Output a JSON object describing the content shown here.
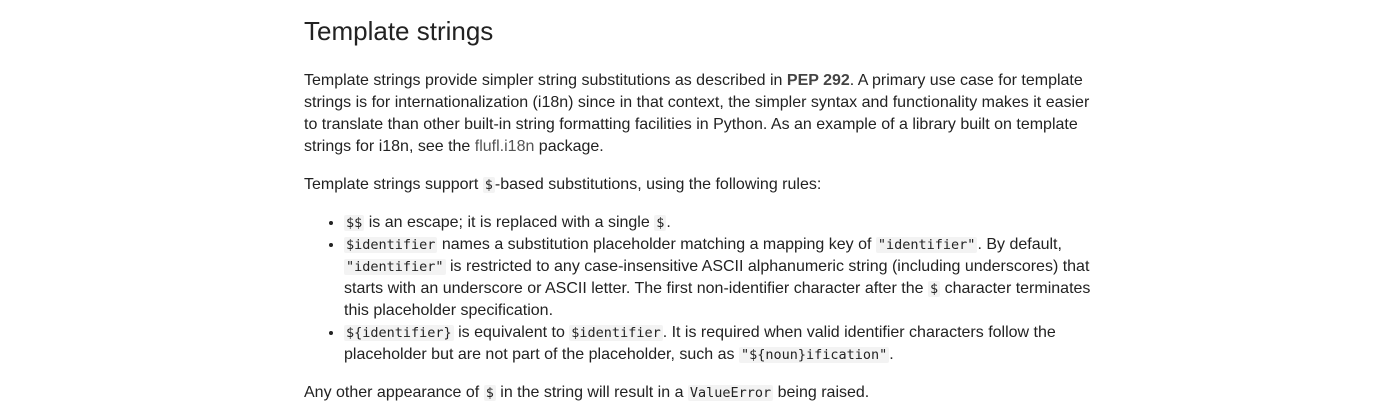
{
  "section": {
    "title": "Template strings"
  },
  "intro": {
    "t1": "Template strings provide simpler string substitutions as described in ",
    "pep_link": "PEP 292",
    "t2": ". A primary use case for template strings is for internationalization (i18n) since in that context, the simpler syntax and functionality makes it easier to translate than other built-in string formatting facilities in Python. As an example of a library built on template strings for i18n, see the ",
    "pkg_link": "flufl.i18n",
    "t3": " package."
  },
  "rules_intro": {
    "t1": "Template strings support ",
    "code": "$",
    "t2": "-based substitutions, using the following rules:"
  },
  "rules": [
    {
      "c1": "$$",
      "t1": " is an escape; it is replaced with a single ",
      "c2": "$",
      "t2": "."
    },
    {
      "c1": "$identifier",
      "t1": " names a substitution placeholder matching a mapping key of ",
      "c2": "\"identifier\"",
      "t2": ". By default, ",
      "c3": "\"identifier\"",
      "t3": " is restricted to any case-insensitive ASCII alphanumeric string (including underscores) that starts with an underscore or ASCII letter. The first non-identifier character after the ",
      "c4": "$",
      "t4": " character terminates this placeholder specification."
    },
    {
      "c1": "${identifier}",
      "t1": " is equivalent to ",
      "c2": "$identifier",
      "t2": ". It is required when valid identifier characters follow the placeholder but are not part of the placeholder, such as ",
      "c3": "\"${noun}ification\"",
      "t3": "."
    }
  ],
  "closing": {
    "t1": "Any other appearance of ",
    "c1": "$",
    "t2": " in the string will result in a ",
    "c2": "ValueError",
    "t3": " being raised."
  }
}
